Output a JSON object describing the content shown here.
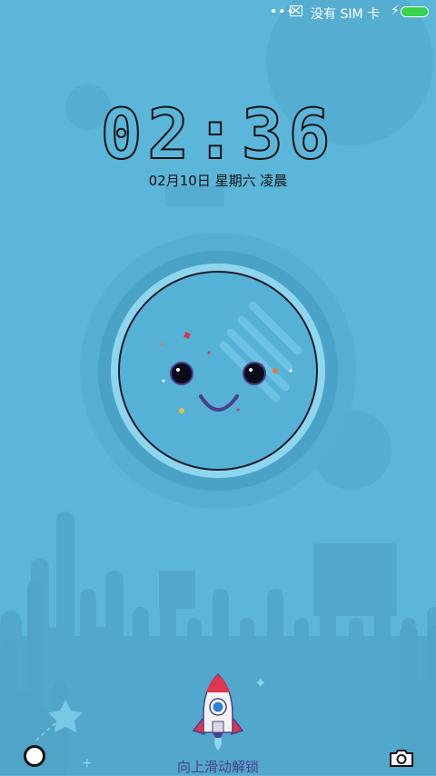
{
  "status_bar": {
    "dots_icon": "more-dots-icon",
    "notification_icon": "mail-box-icon",
    "carrier": "没有 SIM 卡",
    "charging_icon": "lightning-icon",
    "battery_level": 1.0,
    "battery_color": "#36d24a"
  },
  "lockscreen": {
    "time": "02:36",
    "date": "02月10日 星期六 凌晨",
    "unlock_hint": "向上滑动解锁"
  },
  "shortcuts": {
    "left_icon": "circle-shortcut-icon",
    "right_icon": "camera-icon"
  },
  "colors": {
    "background": "#5bb6d9",
    "accent_purple": "#4a3f8c",
    "rocket_red": "#e0344f"
  }
}
